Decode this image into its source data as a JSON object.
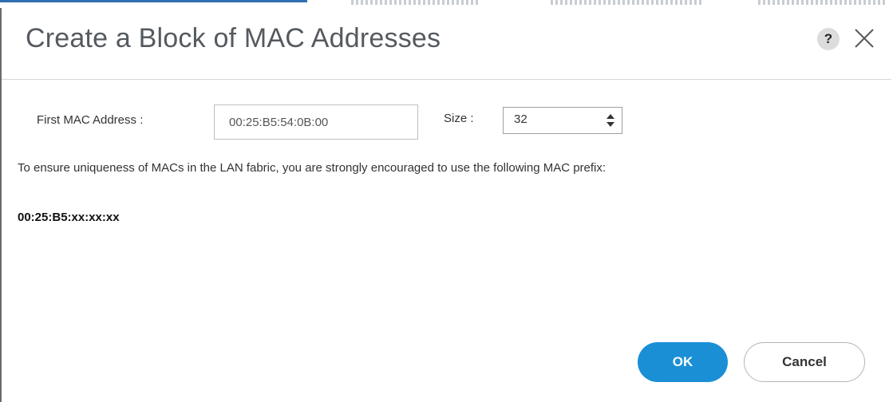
{
  "dialog": {
    "title": "Create a Block of MAC Addresses",
    "help_label": "?",
    "help_icon": "question-mark",
    "close_icon": "x-close"
  },
  "form": {
    "first_mac_label": "First MAC Address :",
    "first_mac_value": "00:25:B5:54:0B:00",
    "size_label": "Size :",
    "size_value": "32",
    "size_spinner_icon": "up-down-arrows"
  },
  "info": {
    "message": "To ensure uniqueness of MACs in the LAN fabric, you are strongly encouraged to use the following MAC prefix:",
    "prefix": "00:25:B5:xx:xx:xx"
  },
  "actions": {
    "ok_label": "OK",
    "cancel_label": "Cancel"
  },
  "colors": {
    "primary_button": "#1a8fd6",
    "title_text": "#555a60",
    "help_circle": "#dcdcdc"
  }
}
